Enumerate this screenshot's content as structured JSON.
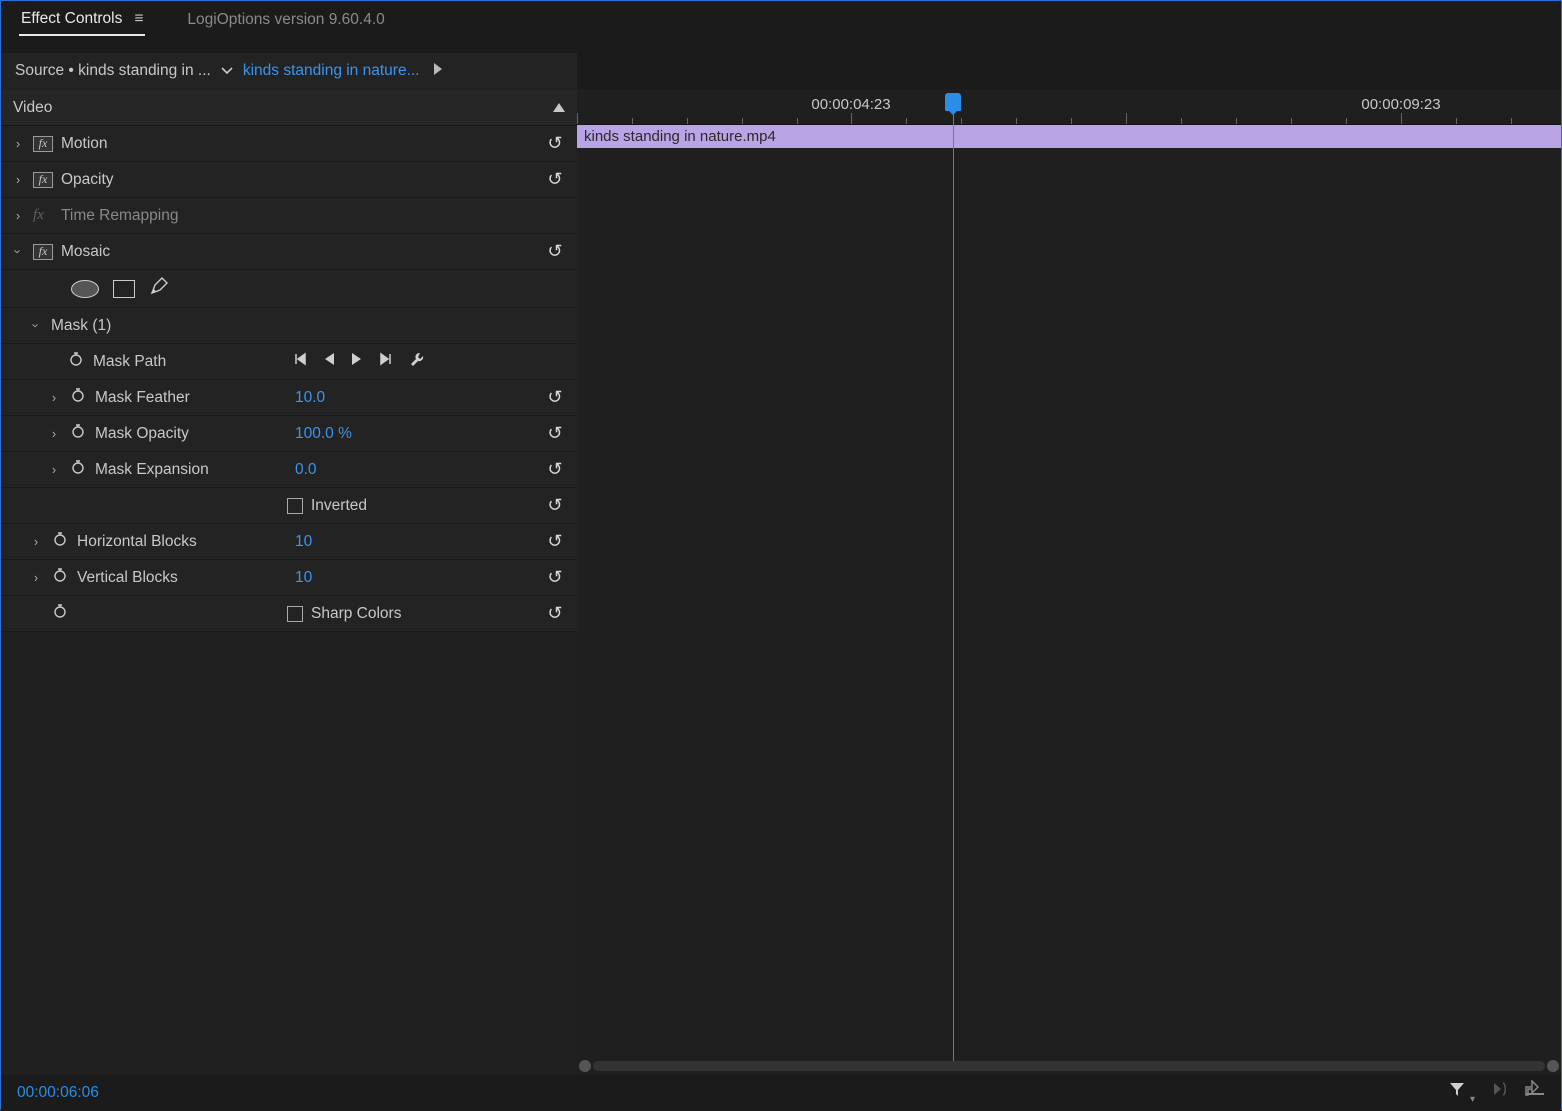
{
  "tabs": {
    "main": "Effect Controls",
    "extra": "LogiOptions version 9.60.4.0"
  },
  "header": {
    "source": "Source • kinds standing in ...",
    "sequence": "kinds standing in nature..."
  },
  "sectionTitle": "Video",
  "effects": {
    "motion": "Motion",
    "opacity": "Opacity",
    "timeRemap": "Time Remapping",
    "mosaic": "Mosaic"
  },
  "mask": {
    "title": "Mask (1)",
    "path": "Mask Path",
    "feather": "Mask Feather",
    "featherVal": "10.0",
    "opacity": "Mask Opacity",
    "opacityVal": "100.0 %",
    "expansion": "Mask Expansion",
    "expansionVal": "0.0",
    "inverted": "Inverted"
  },
  "blocks": {
    "hLabel": "Horizontal Blocks",
    "hVal": "10",
    "vLabel": "Vertical Blocks",
    "vVal": "10",
    "sharp": "Sharp Colors"
  },
  "timeline": {
    "tick1": "00:00:04:23",
    "tick2": "00:00:09:23",
    "clip": "kinds standing in nature.mp4"
  },
  "footer": {
    "timecode": "00:00:06:06"
  }
}
